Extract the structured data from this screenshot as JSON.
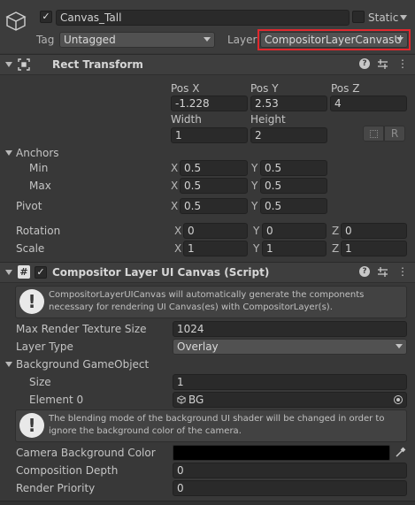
{
  "gameobject": {
    "name": "Canvas_Tall",
    "active_check": "✓",
    "static_label": "Static",
    "tag_label": "Tag",
    "tag_value": "Untagged",
    "layer_label": "Layer",
    "layer_value": "CompositorLayerCanvasU"
  },
  "rect_transform": {
    "title": "Rect Transform",
    "pos_x_label": "Pos X",
    "pos_y_label": "Pos Y",
    "pos_z_label": "Pos Z",
    "pos_x": "-1.228",
    "pos_y": "2.53",
    "pos_z": "4",
    "width_label": "Width",
    "height_label": "Height",
    "width": "1",
    "height": "2",
    "r_button": "R",
    "anchors_label": "Anchors",
    "min_label": "Min",
    "max_label": "Max",
    "min_x": "0.5",
    "min_y": "0.5",
    "max_x": "0.5",
    "max_y": "0.5",
    "pivot_label": "Pivot",
    "pivot_x": "0.5",
    "pivot_y": "0.5",
    "rotation_label": "Rotation",
    "rot_x": "0",
    "rot_y": "0",
    "rot_z": "0",
    "scale_label": "Scale",
    "scale_x": "1",
    "scale_y": "1",
    "scale_z": "1",
    "axis_x": "X",
    "axis_y": "Y",
    "axis_z": "Z"
  },
  "compositor": {
    "title": "Compositor Layer UI Canvas (Script)",
    "enabled_check": "✓",
    "help1": "CompositorLayerUICanvas will automatically generate the components necessary for rendering UI Canvas(es) with CompositorLayer(s).",
    "max_render_label": "Max Render Texture Size",
    "max_render_value": "1024",
    "layer_type_label": "Layer Type",
    "layer_type_value": "Overlay",
    "bg_go_label": "Background GameObject",
    "size_label": "Size",
    "size_value": "1",
    "element0_label": "Element 0",
    "element0_value": "BG",
    "help2": "The blending mode of the background UI shader will be changed in order to ignore the background color of the camera.",
    "cam_bg_label": "Camera Background Color",
    "cam_bg_color": "#000000",
    "comp_depth_label": "Composition Depth",
    "comp_depth_value": "0",
    "render_priority_label": "Render Priority",
    "render_priority_value": "0"
  },
  "colors": {
    "highlight": "#e0282e"
  }
}
